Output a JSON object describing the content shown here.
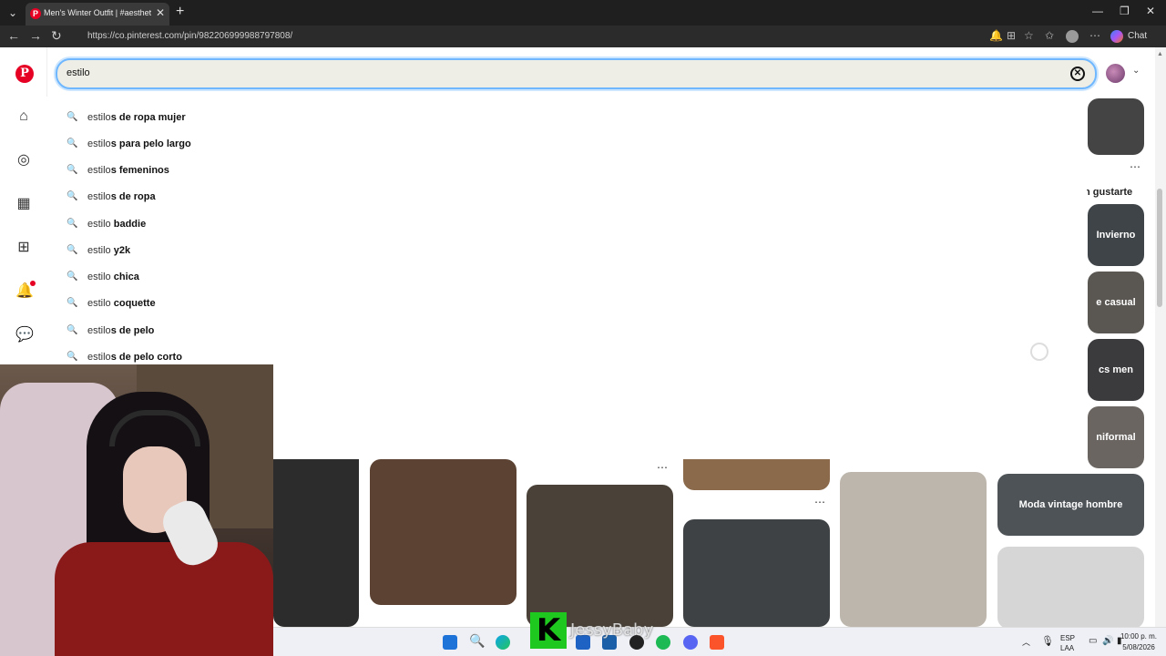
{
  "browser": {
    "tab_title": "Men's Winter Outfit | #aesthetic #",
    "url": "https://co.pinterest.com/pin/982206999988797808/",
    "chat_label": "Chat"
  },
  "search": {
    "value": "estilo",
    "suggestions": [
      {
        "typed": "estilo",
        "rest": "s de ropa mujer"
      },
      {
        "typed": "estilo",
        "rest": "s para pelo largo"
      },
      {
        "typed": "estilo",
        "rest": "s femeninos"
      },
      {
        "typed": "estilo",
        "rest": "s de ropa"
      },
      {
        "typed": "estilo ",
        "rest": "baddie"
      },
      {
        "typed": "estilo ",
        "rest": "y2k"
      },
      {
        "typed": "estilo ",
        "rest": "chica"
      },
      {
        "typed": "estilo ",
        "rest": "coquette"
      },
      {
        "typed": "estilo",
        "rest": "s de pelo"
      },
      {
        "typed": "estilo",
        "rest": "s de pelo corto"
      }
    ]
  },
  "grid": {
    "side_heading": "n gustarte",
    "pin_labels": [
      "Invierno",
      "e casual",
      "cs men",
      "niformal",
      "Moda vintage hombre"
    ]
  },
  "overlay": {
    "stream_letter": "K",
    "stream_name": "JessyBaby"
  },
  "taskbar": {
    "lang_top": "ESP",
    "lang_bottom": "LAA",
    "time": "10:00 p. m.",
    "date": "5/08/2026"
  },
  "colors": {
    "pinterest_red": "#e60023",
    "search_focus": "#6fb7ff",
    "stream_green": "#1ec81e"
  }
}
